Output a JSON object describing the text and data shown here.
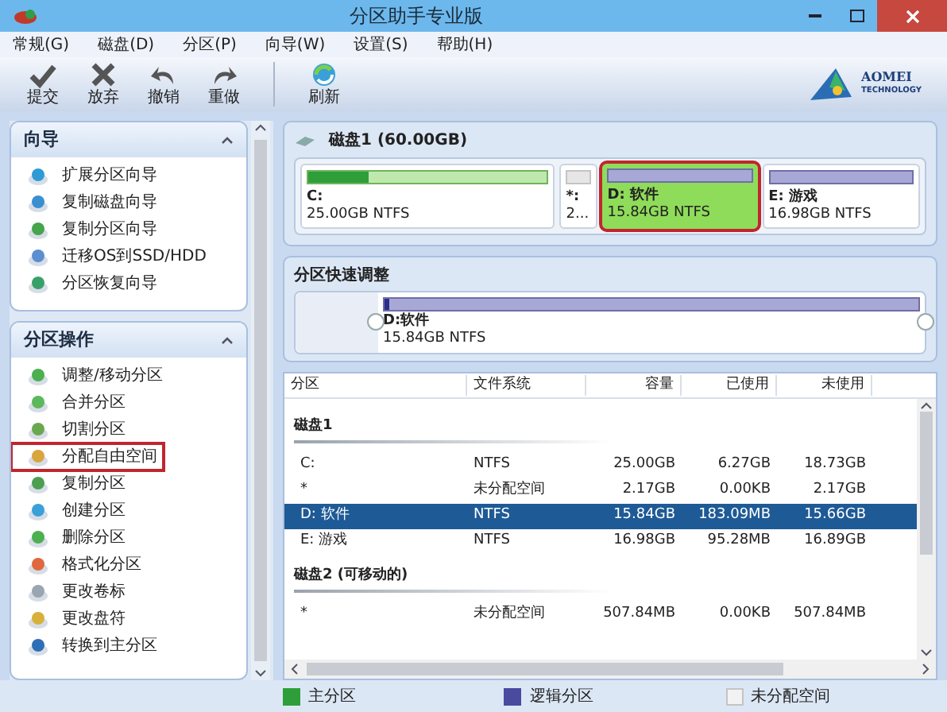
{
  "window": {
    "title": "分区助手专业版"
  },
  "menu": [
    "常规(G)",
    "磁盘(D)",
    "分区(P)",
    "向导(W)",
    "设置(S)",
    "帮助(H)"
  ],
  "toolbar": [
    {
      "label": "提交",
      "kind": "check"
    },
    {
      "label": "放弃",
      "kind": "cross"
    },
    {
      "label": "撤销",
      "kind": "undo"
    },
    {
      "label": "重做",
      "kind": "redo"
    },
    {
      "label": "刷新",
      "kind": "refresh"
    }
  ],
  "logo": {
    "name": "AOMEI",
    "sub": "TECHNOLOGY"
  },
  "sidebar": [
    {
      "title": "向导",
      "expanded": true,
      "items": [
        {
          "label": "扩展分区向导",
          "highlighted": false
        },
        {
          "label": "复制磁盘向导",
          "highlighted": false
        },
        {
          "label": "复制分区向导",
          "highlighted": false
        },
        {
          "label": "迁移OS到SSD/HDD",
          "highlighted": false
        },
        {
          "label": "分区恢复向导",
          "highlighted": false
        }
      ]
    },
    {
      "title": "分区操作",
      "expanded": true,
      "items": [
        {
          "label": "调整/移动分区",
          "highlighted": false
        },
        {
          "label": "合并分区",
          "highlighted": false
        },
        {
          "label": "切割分区",
          "highlighted": false
        },
        {
          "label": "分配自由空间",
          "highlighted": true
        },
        {
          "label": "复制分区",
          "highlighted": false
        },
        {
          "label": "创建分区",
          "highlighted": false
        },
        {
          "label": "删除分区",
          "highlighted": false
        },
        {
          "label": "格式化分区",
          "highlighted": false
        },
        {
          "label": "更改卷标",
          "highlighted": false
        },
        {
          "label": "更改盘符",
          "highlighted": false
        },
        {
          "label": "转换到主分区",
          "highlighted": false
        }
      ]
    }
  ],
  "disk_map": {
    "title": "磁盘1 (60.00GB)",
    "partitions": [
      {
        "kind": "primary",
        "name": "C:",
        "info": "25.00GB NTFS",
        "level": 0.25,
        "selected": false
      },
      {
        "kind": "unallocated",
        "name": "*:",
        "info": "2...",
        "selected": false
      },
      {
        "kind": "logical",
        "name": "D: 软件",
        "info": "15.84GB NTFS",
        "selected": true
      },
      {
        "kind": "logical",
        "name": "E: 游戏",
        "info": "16.98GB NTFS",
        "selected": false
      }
    ]
  },
  "quick_adjust": {
    "title": "分区快速调整",
    "name": "D:软件",
    "info": "15.84GB NTFS",
    "level": 0.01
  },
  "table": {
    "columns": [
      "分区",
      "文件系统",
      "容量",
      "已使用",
      "未使用"
    ],
    "groups": [
      {
        "title": "磁盘1",
        "rows": [
          {
            "cells": [
              "C:",
              "NTFS",
              "25.00GB",
              "6.27GB",
              "18.73GB"
            ],
            "selected": false
          },
          {
            "cells": [
              "*",
              "未分配空间",
              "2.17GB",
              "0.00KB",
              "2.17GB"
            ],
            "selected": false
          },
          {
            "cells": [
              "D: 软件",
              "NTFS",
              "15.84GB",
              "183.09MB",
              "15.66GB"
            ],
            "selected": true
          },
          {
            "cells": [
              "E: 游戏",
              "NTFS",
              "16.98GB",
              "95.28MB",
              "16.89GB"
            ],
            "selected": false
          }
        ]
      },
      {
        "title": "磁盘2 (可移动的)",
        "rows": [
          {
            "cells": [
              "*",
              "未分配空间",
              "507.84MB",
              "0.00KB",
              "507.84MB"
            ],
            "selected": false
          }
        ]
      }
    ]
  },
  "legend": [
    {
      "kind": "primary",
      "label": "主分区"
    },
    {
      "kind": "logical",
      "label": "逻辑分区"
    },
    {
      "kind": "unallocated",
      "label": "未分配空间"
    }
  ]
}
